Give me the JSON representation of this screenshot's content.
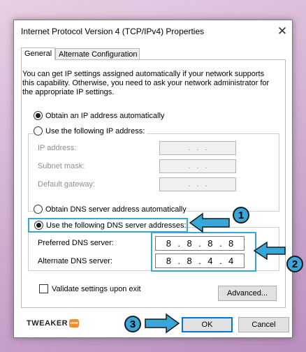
{
  "window": {
    "title": "Internet Protocol Version 4 (TCP/IPv4) Properties",
    "close_glyph": "✕"
  },
  "tabs": [
    {
      "label": "General",
      "selected": true
    },
    {
      "label": "Alternate Configuration",
      "selected": false
    }
  ],
  "intro_text": "You can get IP settings assigned automatically if your network supports this capability. Otherwise, you need to ask your network administrator for the appropriate IP settings.",
  "ip_section": {
    "auto_option": {
      "label": "Obtain an IP address automatically",
      "selected": true
    },
    "manual_option": {
      "label": "Use the following IP address:",
      "selected": false
    },
    "fields": [
      {
        "label": "IP address:",
        "value": ".   .   ."
      },
      {
        "label": "Subnet mask:",
        "value": ".   .   ."
      },
      {
        "label": "Default gateway:",
        "value": ".   .   ."
      }
    ]
  },
  "dns_section": {
    "auto_option": {
      "label": "Obtain DNS server address automatically",
      "selected": false
    },
    "manual_option": {
      "label": "Use the following DNS server addresses:",
      "selected": true
    },
    "preferred": {
      "label": "Preferred DNS server:",
      "octets": [
        "8",
        "8",
        "8",
        "8"
      ]
    },
    "alternate": {
      "label": "Alternate DNS server:",
      "octets": [
        "8",
        "8",
        "4",
        "4"
      ]
    }
  },
  "validate_checkbox": {
    "label": "Validate settings upon exit",
    "checked": false
  },
  "buttons": {
    "advanced": "Advanced...",
    "ok": "OK",
    "cancel": "Cancel"
  },
  "callouts": [
    "1",
    "2",
    "3"
  ],
  "logo": {
    "text": "TWEAKER",
    "badge": "zone"
  },
  "colors": {
    "highlight": "#37a6d8",
    "background": "#d8b8d8"
  }
}
